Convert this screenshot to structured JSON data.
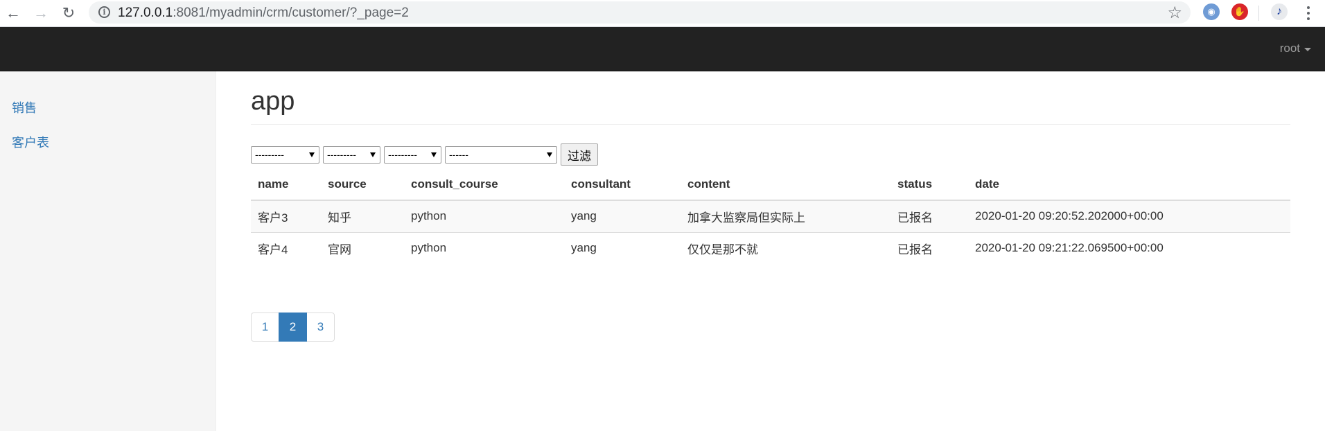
{
  "browser": {
    "back_icon": "←",
    "forward_icon": "→",
    "reload_icon": "↻",
    "url_host": "127.0.0.1",
    "url_rest": ":8081/myadmin/crm/customer/?_page=2",
    "star_icon": "☆"
  },
  "navbar": {
    "user": "root"
  },
  "sidebar": {
    "items": [
      {
        "label": "销售"
      },
      {
        "label": "客户表"
      }
    ]
  },
  "main": {
    "title": "app"
  },
  "filters": {
    "selects": [
      {
        "value": "---------"
      },
      {
        "value": "---------"
      },
      {
        "value": "---------"
      },
      {
        "value": "------"
      }
    ],
    "button": "过滤"
  },
  "table": {
    "headers": [
      "name",
      "source",
      "consult_course",
      "consultant",
      "content",
      "status",
      "date"
    ],
    "rows": [
      [
        "客户3",
        "知乎",
        "python",
        "yang",
        "加拿大监察局但实际上",
        "已报名",
        "2020-01-20 09:20:52.202000+00:00"
      ],
      [
        "客户4",
        "官网",
        "python",
        "yang",
        "仅仅是那不就",
        "已报名",
        "2020-01-20 09:21:22.069500+00:00"
      ]
    ]
  },
  "pagination": {
    "pages": [
      "1",
      "2",
      "3"
    ],
    "active": "2"
  },
  "colors": {
    "link": "#337ab7",
    "navbar": "#222222",
    "sidebar": "#f5f5f5"
  }
}
